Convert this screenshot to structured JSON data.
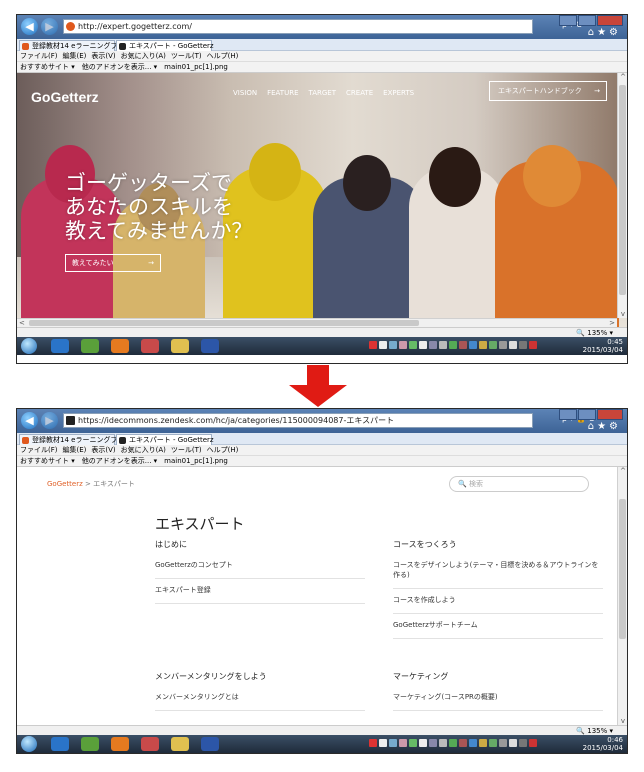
{
  "browser_top": {
    "url": "http://expert.gogetterz.com/",
    "addr_tools": "ρ ▾ C",
    "tabs": [
      "登録教材14 eラーニングプ...",
      "エキスパート - GoGetterz"
    ],
    "menu": [
      "ファイル(F)",
      "編集(E)",
      "表示(V)",
      "お気に入り(A)",
      "ツール(T)",
      "ヘルプ(H)"
    ],
    "favorites": [
      "おすすめサイト ▾",
      "他のアドオンを表示... ▾",
      "main01_pc[1].png"
    ],
    "zoom": "🔍 135% ▾"
  },
  "hero": {
    "logo": "GoGetterz",
    "nav": [
      "VISION",
      "FEATURE",
      "TARGET",
      "CREATE",
      "EXPERTS"
    ],
    "handbook_label": "エキスパートハンドブック",
    "arrow": "→",
    "lines": [
      "ゴーゲッターズで",
      "あなたのスキルを",
      "教えてみませんか？"
    ],
    "cta_label": "教えてみたい"
  },
  "browser_bottom": {
    "url": "https://idecommons.zendesk.com/hc/ja/categories/115000094087-エキスパート",
    "addr_tools": "ρ ▾ 🔒 C",
    "tabs": [
      "登録教材14 eラーニングプ...",
      "エキスパート - GoGetterz"
    ],
    "menu": [
      "ファイル(F)",
      "編集(E)",
      "表示(V)",
      "お気に入り(A)",
      "ツール(T)",
      "ヘルプ(H)"
    ],
    "favorites": [
      "おすすめサイト ▾",
      "他のアドオンを表示... ▾",
      "main01_pc[1].png"
    ],
    "zoom": "🔍 135% ▾"
  },
  "help_center": {
    "breadcrumb_brand": "GoGetterz",
    "breadcrumb_sep": ">",
    "breadcrumb_current": "エキスパート",
    "search_placeholder": "🔍 検索",
    "title": "エキスパート",
    "sections": [
      {
        "heading": "はじめに",
        "items": [
          "GoGetterzのコンセプト",
          "エキスパート登録"
        ]
      },
      {
        "heading": "コースをつくろう",
        "items": [
          "コースをデザインしよう(テーマ・目標を決める＆アウトラインを作る)",
          "コースを作成しよう",
          "GoGetterzサポートチーム"
        ]
      },
      {
        "heading": "メンバーメンタリングをしよう",
        "items": [
          "メンバーメンタリングとは"
        ]
      },
      {
        "heading": "マーケティング",
        "items": [
          "マーケティング(コースPRの概要)"
        ]
      }
    ]
  },
  "taskbar": {
    "clock_time": "0:45",
    "clock_date": "2015/03/04",
    "clock_time2": "0:46"
  },
  "colors": {
    "accent_red": "#e01b14",
    "brand_orange": "#e0622a",
    "ie_frame": "#4a70a5"
  }
}
